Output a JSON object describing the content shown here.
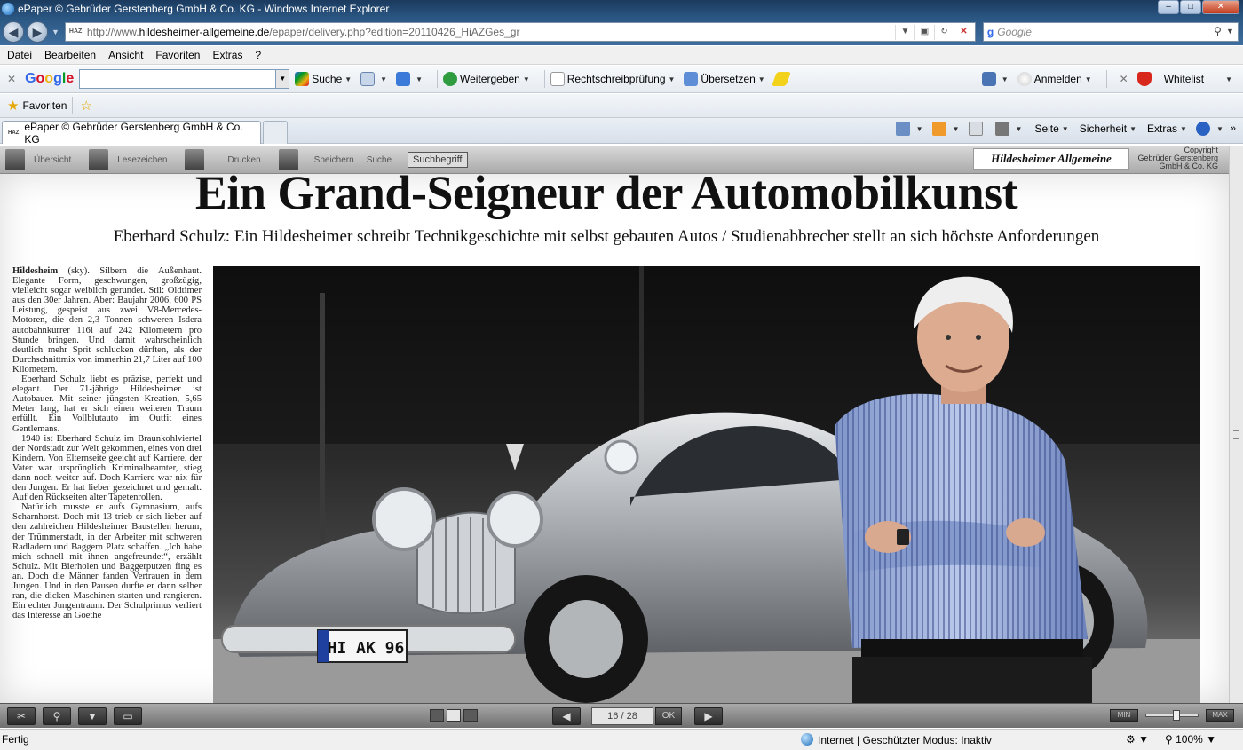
{
  "window": {
    "title": "ePaper © Gebrüder Gerstenberg GmbH & Co. KG - Windows Internet Explorer",
    "buttons": {
      "minimize": "–",
      "maximize": "□",
      "close": "✕"
    }
  },
  "address": {
    "favicon_text": "HAZ",
    "url_prefix": "http://www.",
    "url_domain": "hildesheimer-allgemeine.de",
    "url_path": "/epaper/delivery.php?edition=20110426_HiAZGes_gr",
    "search_placeholder": "Google"
  },
  "menu": [
    "Datei",
    "Bearbeiten",
    "Ansicht",
    "Favoriten",
    "Extras",
    "?"
  ],
  "google_toolbar": {
    "suche": "Suche",
    "weitergeben": "Weitergeben",
    "rechtschreibpruefung": "Rechtschreibprüfung",
    "uebersetzen": "Übersetzen",
    "anmelden": "Anmelden",
    "whitelist": "Whitelist"
  },
  "favorites_bar": {
    "label": "Favoriten"
  },
  "tab": {
    "favicon_text": "HAZ",
    "label": "ePaper © Gebrüder Gerstenberg GmbH & Co. KG"
  },
  "command_bar": {
    "seite": "Seite",
    "sicherheit": "Sicherheit",
    "extras": "Extras"
  },
  "epaper_toolbar": {
    "uebersicht": "Übersicht",
    "lesezeichen": "Lesezeichen",
    "drucken": "Drucken",
    "speichern": "Speichern",
    "suche": "Suche",
    "suchbegriff": "Suchbegriff",
    "brand": "Hildesheimer Allgemeine Zeitung",
    "copyright_1": "Copyright",
    "copyright_2": "Gebrüder Gerstenberg",
    "copyright_3": "GmbH & Co. KG"
  },
  "article": {
    "headline": "Ein Grand-Seigneur der Automobilkunst",
    "subhead": "Eberhard Schulz: Ein Hildesheimer schreibt Technikgeschichte mit selbst gebauten Autos  / Studienabbrecher stellt an sich höchste Anforderungen",
    "dateline": "Hildesheim",
    "p1": " (sky). Silbern die Außenhaut. Elegante Form, geschwungen, großzügig, vielleicht sogar weiblich gerundet. Stil: Oldtimer aus den 30er Jahren. Aber: Baujahr 2006, 600 PS Leistung, gespeist aus zwei V8-Mercedes-Motoren, die den 2,3 Tonnen schweren Isdera autobahnkurrer 116i auf 242 Kilometern pro Stunde bringen. Und damit wahrscheinlich deutlich mehr Sprit schlucken dürften, als der Durchschnittmix von immerhin 21,7 Liter auf 100 Kilometern.",
    "p2": "Eberhard Schulz liebt es präzise, perfekt und elegant. Der 71-jährige Hildesheimer ist Autobauer. Mit seiner jüngsten Kreation, 5,65 Meter lang, hat er sich einen weiteren Traum erfüllt. Ein Vollblutauto im Outfit eines Gentlemans.",
    "p3": "1940 ist Eberhard Schulz im Braunkohlviertel der Nordstadt zur Welt gekommen, eines von drei Kindern. Von Elternseite geeicht auf Karriere, der Vater war ursprünglich Kriminalbeamter, stieg dann noch weiter auf. Doch Karriere war nix für den Jungen. Er hat lieber gezeichnet und gemalt. Auf den Rückseiten alter Tapetenrollen.",
    "p4": "Natürlich musste er aufs Gymnasium, aufs Scharnhorst. Doch mit 13 trieb er sich lieber auf den zahlreichen Hildesheimer Baustellen herum, der Trümmerstadt, in der Arbeiter mit schweren Radladern und Baggern Platz schaffen. „Ich habe mich schnell mit ihnen angefreundet“, erzählt Schulz. Mit Bierholen und Baggerputzen fing es an. Doch die Männer fanden Vertrauen in dem Jungen. Und in den Pausen durfte er dann selber ran, die dicken Maschinen starten und rangieren. Ein echter Jungentraum. Der Schulprimus verliert das Interesse an Goethe",
    "license_plate": "HI AK 96"
  },
  "pager": {
    "page": "16 / 28",
    "ok": "OK",
    "min": "MIN",
    "max": "MAX"
  },
  "status": {
    "text": "Fertig",
    "zone": "Internet | Geschützter Modus: Inaktiv",
    "zoom": "100%"
  }
}
